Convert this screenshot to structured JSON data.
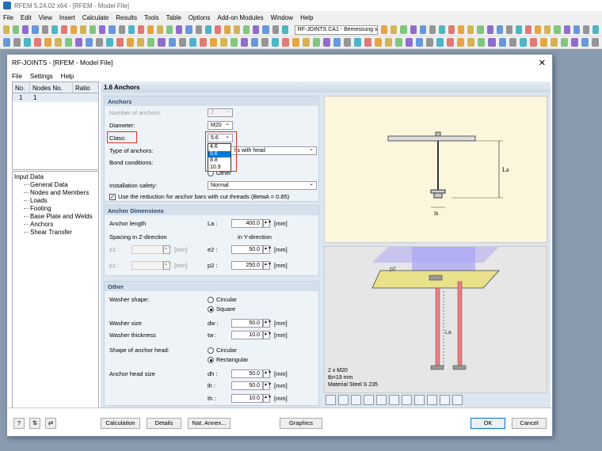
{
  "app": {
    "title": "RFEM 5.24.02 x64 - [RFEM - Model File]"
  },
  "menubar": [
    "File",
    "Edit",
    "View",
    "Insert",
    "Calculate",
    "Results",
    "Tools",
    "Table",
    "Options",
    "Add-on Modules",
    "Window",
    "Help"
  ],
  "toolbar_combo": "RF-JOINTS CA1 - Bemessung von Ansch",
  "dialog": {
    "title": "RF-JOINTS - [RFEM - Model File]",
    "menu": [
      "File",
      "Settings",
      "Help"
    ],
    "nav_table": {
      "headers": [
        "No.",
        "Nodes No.",
        "Ratio"
      ],
      "rows": [
        [
          "1",
          "1",
          ""
        ]
      ]
    },
    "tree": {
      "root": "Input Data",
      "items": [
        "General Data",
        "Nodes and Members",
        "Loads",
        "Footing",
        "Base Plate and Welds",
        "Anchors",
        "Shear Transfer"
      ]
    },
    "section_title": "1.6 Anchors",
    "anchors": {
      "header": "Anchors",
      "number_label": "Number of anchors:",
      "number_value": "2",
      "diameter_label": "Diameter:",
      "diameter_value": "M20",
      "class_label": "Class:",
      "class_value": "5.6",
      "class_options": [
        "4.6",
        "5.6",
        "8.8",
        "10.9"
      ],
      "type_label": "Type of anchors:",
      "type_value": "lts with head",
      "bond_label": "Bond conditions:",
      "bond_other": "Other",
      "install_label": "Installation safety:",
      "install_value": "Normal",
      "reduction_label": "Use the reduction for anchor bars with cut threads (BetaA = 0.85)"
    },
    "dimensions": {
      "header": "Anchor Dimensions",
      "length_label": "Anchor length",
      "length_sym": "La :",
      "length_value": "400.0",
      "unit": "[mm]",
      "spacing_z": "Spacing in Z-direction",
      "spacing_y": "in Y-direction",
      "e1_sym": "e1 :",
      "e1_value": "",
      "e2_sym": "e2 :",
      "e2_value": "50.0",
      "p1_sym": "p1 :",
      "p1_value": "",
      "p2_sym": "p2 :",
      "p2_value": "250.0"
    },
    "other": {
      "header": "Other",
      "washer_shape_label": "Washer shape:",
      "circular": "Circular",
      "square": "Square",
      "washer_size_label": "Washer size",
      "washer_size_sym": "dw :",
      "washer_size_value": "50.0",
      "washer_thick_label": "Washer thickness",
      "washer_thick_sym": "tw :",
      "washer_thick_value": "10.0",
      "head_shape_label": "Shape of anchor head:",
      "rectangular": "Rectangular",
      "head_size_label": "Anchor head size",
      "dh_sym": "dh :",
      "dh_value": "50.0",
      "lh_sym": "lh :",
      "lh_value": "50.0",
      "th_sym": "th :",
      "th_value": "10.0"
    },
    "image_info": [
      "2 x M20",
      "tb=19 mm",
      "Material Steel S 235"
    ],
    "image_labels": {
      "la": "La",
      "lh": "lh",
      "p2": "p2"
    },
    "buttons": {
      "calculation": "Calculation",
      "details": "Details",
      "nat_annex": "Nat. Annex...",
      "graphics": "Graphics",
      "ok": "OK",
      "cancel": "Cancel"
    }
  }
}
